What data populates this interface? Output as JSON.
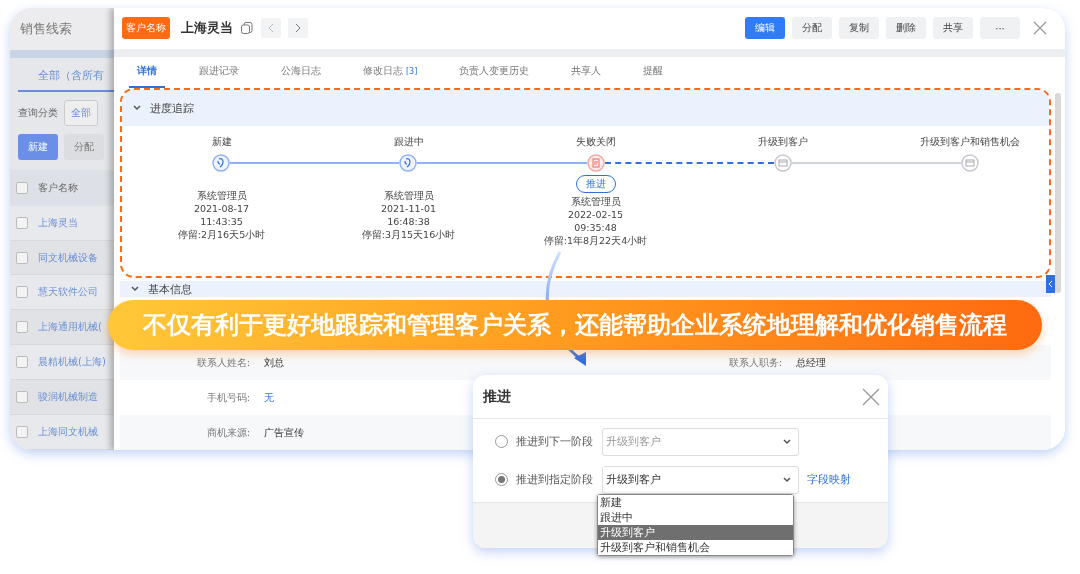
{
  "sidebar": {
    "title": "销售线索",
    "tab": "全部（含所有",
    "filter_label": "查询分类",
    "filter_value": "全部",
    "buttons": [
      {
        "label": "新建",
        "kind": "primary"
      },
      {
        "label": "分配",
        "kind": "plain"
      }
    ],
    "table": {
      "column": "客户名称",
      "header_checked": false,
      "rows": [
        {
          "name": "上海灵当",
          "checked": false
        },
        {
          "name": "同文机械设备",
          "checked": false
        },
        {
          "name": "慧天软件公司",
          "checked": false
        },
        {
          "name": "上海通用机械(",
          "checked": false
        },
        {
          "name": "晨精机械(上海)",
          "checked": false
        },
        {
          "name": "骏润机械制造",
          "checked": false
        },
        {
          "name": "上海同文机械",
          "checked": false
        }
      ]
    }
  },
  "record": {
    "tag": "客户名称",
    "name": "上海灵当",
    "buttons": [
      {
        "label": "编辑",
        "kind": "primary"
      },
      {
        "label": "分配",
        "kind": "plain"
      },
      {
        "label": "复制",
        "kind": "plain"
      },
      {
        "label": "删除",
        "kind": "plain"
      },
      {
        "label": "共享",
        "kind": "plain"
      },
      {
        "label": "···",
        "kind": "plain"
      }
    ],
    "tabs": [
      {
        "label": "详情",
        "selected": true
      },
      {
        "label": "跟进记录",
        "selected": false
      },
      {
        "label": "公海日志",
        "selected": false
      },
      {
        "label": "修改日志",
        "badge": "[3]",
        "selected": false
      },
      {
        "label": "负责人变更历史",
        "selected": false
      },
      {
        "label": "共享人",
        "selected": false
      },
      {
        "label": "提醒",
        "selected": false
      }
    ]
  },
  "progress": {
    "title": "进度追踪",
    "advance_button": "推进",
    "stages": [
      {
        "label": "新建",
        "kind": "done",
        "user": "系统管理员",
        "date": "2021-08-17",
        "time": "11:43:35",
        "stay": "停留:2月16天5小时"
      },
      {
        "label": "跟进中",
        "kind": "done",
        "user": "系统管理员",
        "date": "2021-11-01",
        "time": "16:48:38",
        "stay": "停留:3月15天16小时"
      },
      {
        "label": "失败关闭",
        "kind": "failed",
        "user": "系统管理员",
        "date": "2022-02-15",
        "time": "09:35:48",
        "stay": "停留:1年8月22天4小时"
      },
      {
        "label": "升级到客户",
        "kind": "pending"
      },
      {
        "label": "升级到客户和销售机会",
        "kind": "pending"
      }
    ]
  },
  "basic_info": {
    "title": "基本信息",
    "fields": [
      {
        "label": "联系人姓名:",
        "value": "刘总",
        "right_label": "联系人职务:",
        "right_value": "总经理"
      },
      {
        "label": "手机号码:",
        "value": "无",
        "kind": "link"
      },
      {
        "label": "商机来源:",
        "value": "广告宣传",
        "kind": "text"
      }
    ]
  },
  "banner": "不仅有利于更好地跟踪和管理客户关系，还能帮助企业系统地理解和优化销售流程",
  "dialog": {
    "title": "推进",
    "options": [
      {
        "label": "推进到下一阶段",
        "selected": false,
        "value": "升级到客户",
        "disabled": true
      },
      {
        "label": "推进到指定阶段",
        "selected": true,
        "value": "升级到客户",
        "disabled": false,
        "link": "字段映射"
      }
    ],
    "dropdown": [
      {
        "label": "新建",
        "selected": false
      },
      {
        "label": "跟进中",
        "selected": false
      },
      {
        "label": "升级到客户",
        "selected": true
      },
      {
        "label": "升级到客户和销售机会",
        "selected": false
      }
    ]
  }
}
